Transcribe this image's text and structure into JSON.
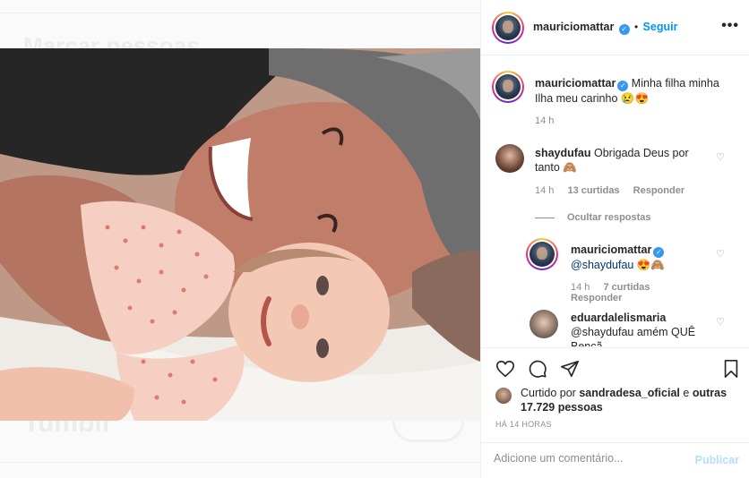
{
  "background": {
    "title": "Marcar pessoas",
    "brand": "Tumblr"
  },
  "post": {
    "author": "mauriciomattar",
    "follow_label": "Seguir",
    "more_icon": "more-options-icon",
    "photo_alt": "Foto de pai e bebê sorrindo deitados juntos"
  },
  "caption": {
    "username": "mauriciomattar",
    "text": "Minha filha minha Ilha meu carinho 😢😍",
    "time": "14 h"
  },
  "comments": [
    {
      "username": "shaydufau",
      "text": "Obrigada Deus por tanto 🙈",
      "time": "14 h",
      "likes": "13 curtidas",
      "reply": "Responder",
      "hide_replies": "Ocultar respostas"
    }
  ],
  "replies": [
    {
      "username": "mauriciomattar",
      "text": "@shaydufau 😍🙈",
      "time": "14 h",
      "likes": "7 curtidas",
      "reply": "Responder"
    },
    {
      "username": "eduardalelismaria",
      "text": "@shaydufau amém QUÊ Bençã"
    }
  ],
  "likes_summary": {
    "prefix": "Curtido por",
    "user": "sandradesa_oficial",
    "middle": "e",
    "others": "outras 17.729 pessoas"
  },
  "time_ago": "HÁ 14 HORAS",
  "add_comment": {
    "placeholder": "Adicione um comentário...",
    "publish_label": "Publicar"
  },
  "colors": {
    "link": "#0095f6",
    "verified": "#3897f0",
    "muted": "#8e8e8e",
    "publish_disabled": "#b2dffc"
  }
}
